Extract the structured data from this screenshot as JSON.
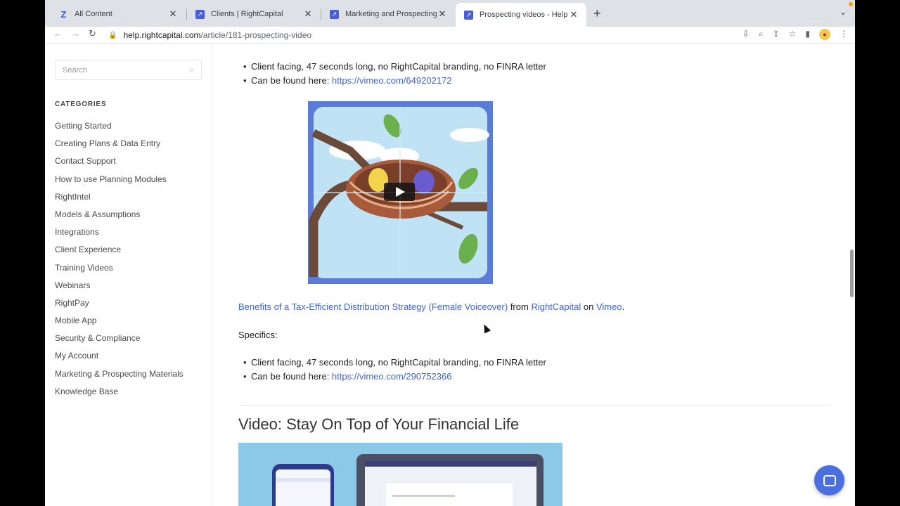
{
  "tabs": [
    {
      "title": "All Content"
    },
    {
      "title": "Clients | RightCapital"
    },
    {
      "title": "Marketing and Prospecting - H"
    },
    {
      "title": "Prospecting videos - Help Cen"
    }
  ],
  "address": {
    "domain": "help.rightcapital.com",
    "path": "/article/181-prospecting-video"
  },
  "sidebar": {
    "search_placeholder": "Search",
    "categories_heading": "CATEGORIES",
    "items": [
      "Getting Started",
      "Creating Plans & Data Entry",
      "Contact Support",
      "How to use Planning Modules",
      "RightIntel",
      "Models & Assumptions",
      "Integrations",
      "Client Experience",
      "Training Videos",
      "Webinars",
      "RightPay",
      "Mobile App",
      "Security & Compliance",
      "My Account",
      "Marketing & Prospecting Materials",
      "Knowledge Base"
    ]
  },
  "article": {
    "top_bullets": {
      "detail": "Client facing, 47 seconds long, no RightCapital branding, no FINRA letter",
      "found_label": "Can be found here: ",
      "found_link": "https://vimeo.com/649202172"
    },
    "attribution": {
      "video_title": "Benefits of a Tax-Efficient Distribution Strategy (Female Voiceover)",
      "from": " from ",
      "author": "RightCapital",
      "on": " on ",
      "platform": "Vimeo",
      "end": "."
    },
    "specifics_label": "Specifics:",
    "bottom_bullets": {
      "detail": "Client facing, 47 seconds long, no RightCapital branding, no FINRA letter",
      "found_label": "Can be found here: ",
      "found_link": "https://vimeo.com/290752366"
    },
    "section_heading": "Video: Stay On Top of Your Financial Life"
  }
}
